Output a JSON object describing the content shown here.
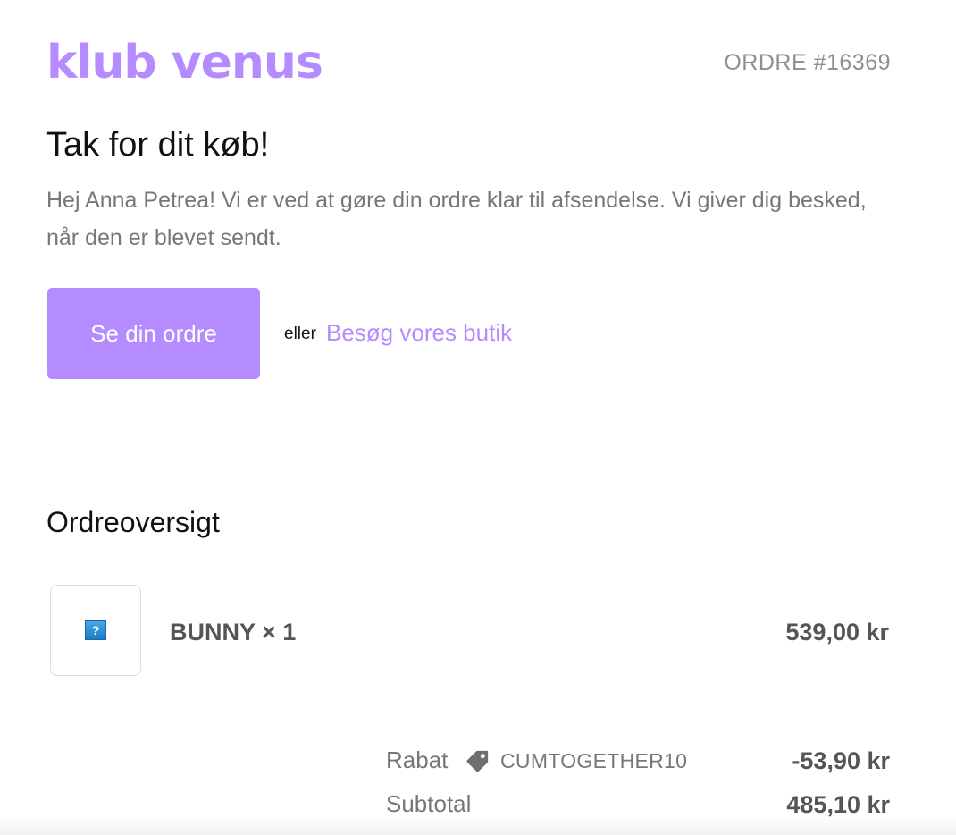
{
  "header": {
    "logo_text": "klub venus",
    "order_number": "ORDRE #16369"
  },
  "confirmation": {
    "title": "Tak for dit køb!",
    "message": "Hej Anna Petrea! Vi er ved at gøre din ordre klar til afsendelse. Vi giver dig besked, når den er blevet sendt."
  },
  "actions": {
    "view_order_label": "Se din ordre",
    "or_text": "eller",
    "shop_link_label": "Besøg vores butik"
  },
  "summary": {
    "title": "Ordreoversigt",
    "items": [
      {
        "name": "BUNNY × 1",
        "price": "539,00 kr",
        "image_icon": "missing-image-icon"
      }
    ],
    "discount": {
      "label": "Rabat",
      "icon": "tag-icon",
      "code": "CUMTOGETHER10",
      "value": "-53,90 kr"
    },
    "subtotal": {
      "label": "Subtotal",
      "value": "485,10 kr"
    }
  },
  "colors": {
    "brand": "#b48cff",
    "muted_text": "#777777",
    "strong_text": "#555555"
  }
}
